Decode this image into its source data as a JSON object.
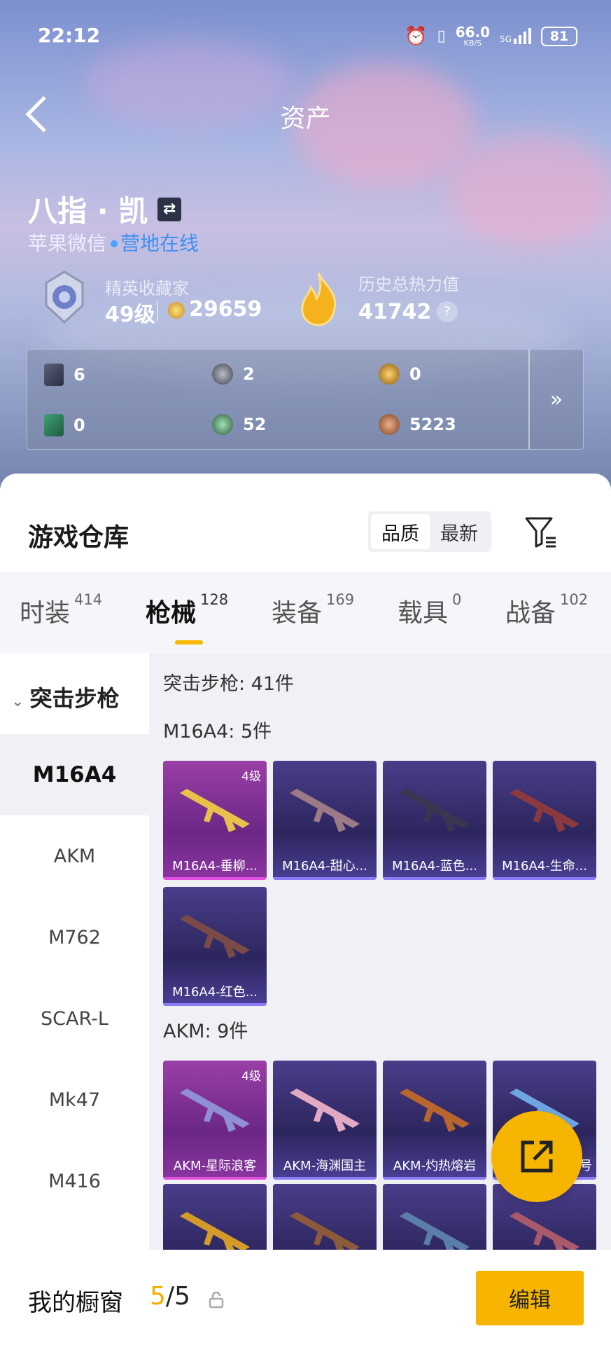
{
  "status_bar": {
    "time": "22:12",
    "net_speed": "66.0",
    "net_unit": "KB/S",
    "signal": "5G",
    "battery": "81"
  },
  "header": {
    "title": "资产"
  },
  "profile": {
    "name": "八指 · 凯",
    "platform": "苹果微信",
    "online_status": "营地在线",
    "collector_title": "精英收藏家",
    "level": "49级",
    "coins": "29659",
    "heat_label": "历史总热力值",
    "heat_value": "41742",
    "help": "?"
  },
  "resources": [
    {
      "icon": "card-icon",
      "value": "6"
    },
    {
      "icon": "silver-coin-icon",
      "value": "2"
    },
    {
      "icon": "gold-coin-icon",
      "value": "0"
    },
    {
      "icon": "green-card-icon",
      "value": "0"
    },
    {
      "icon": "green-coin-icon",
      "value": "52"
    },
    {
      "icon": "bronze-coin-icon",
      "value": "5223"
    }
  ],
  "resources_more": "»",
  "warehouse": {
    "title": "游戏仓库",
    "sort_options": [
      "品质",
      "最新"
    ],
    "tabs": [
      {
        "label": "时装",
        "count": "414"
      },
      {
        "label": "枪械",
        "count": "128"
      },
      {
        "label": "装备",
        "count": "169"
      },
      {
        "label": "载具",
        "count": "0"
      },
      {
        "label": "战备",
        "count": "102"
      }
    ],
    "category": "突击步枪",
    "sidebar": [
      "M16A4",
      "AKM",
      "M762",
      "SCAR-L",
      "Mk47",
      "M416"
    ],
    "summary": "突击步枪: 41件",
    "groups": [
      {
        "title": "M16A4: 5件",
        "items": [
          {
            "label": "M16A4-垂柳...",
            "level": "4级"
          },
          {
            "label": "M16A4-甜心...",
            "level": ""
          },
          {
            "label": "M16A4-蓝色...",
            "level": ""
          },
          {
            "label": "M16A4-生命...",
            "level": ""
          },
          {
            "label": "M16A4-红色...",
            "level": ""
          }
        ]
      },
      {
        "title": "AKM: 9件",
        "items": [
          {
            "label": "AKM-星际浪客",
            "level": "4级"
          },
          {
            "label": "AKM-海渊国主",
            "level": ""
          },
          {
            "label": "AKM-灼热熔岩",
            "level": ""
          },
          {
            "label": "号",
            "level": ""
          }
        ]
      }
    ]
  },
  "showcase": {
    "title": "我的橱窗",
    "current": "5",
    "sep_total": "/5",
    "edit": "编辑"
  },
  "colors": {
    "accent": "#f6b500",
    "online": "#3e8ff0",
    "legend_card": "#9a3fa6",
    "epic_card": "#3a3275"
  }
}
